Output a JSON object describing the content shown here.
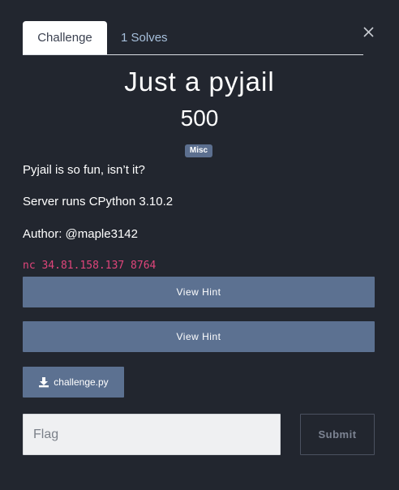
{
  "tabs": {
    "challenge": "Challenge",
    "solves": "1 Solves"
  },
  "challenge": {
    "title": "Just a pyjail",
    "points": "500",
    "category": "Misc",
    "description": [
      "Pyjail is so fun, isn’t it?",
      "Server runs CPython 3.10.2",
      "Author: @maple3142"
    ],
    "connection": "nc 34.81.158.137 8764"
  },
  "hints": [
    {
      "label": "View Hint"
    },
    {
      "label": "View Hint"
    }
  ],
  "file": {
    "name": "challenge.py",
    "icon": "download-icon"
  },
  "submission": {
    "placeholder": "Flag",
    "value": "",
    "submit_label": "Submit"
  },
  "colors": {
    "background": "#22262f",
    "button": "#5c7191",
    "badge": "#5c6f8f",
    "command": "#e0457b",
    "tab_link": "#a7c0dc"
  }
}
